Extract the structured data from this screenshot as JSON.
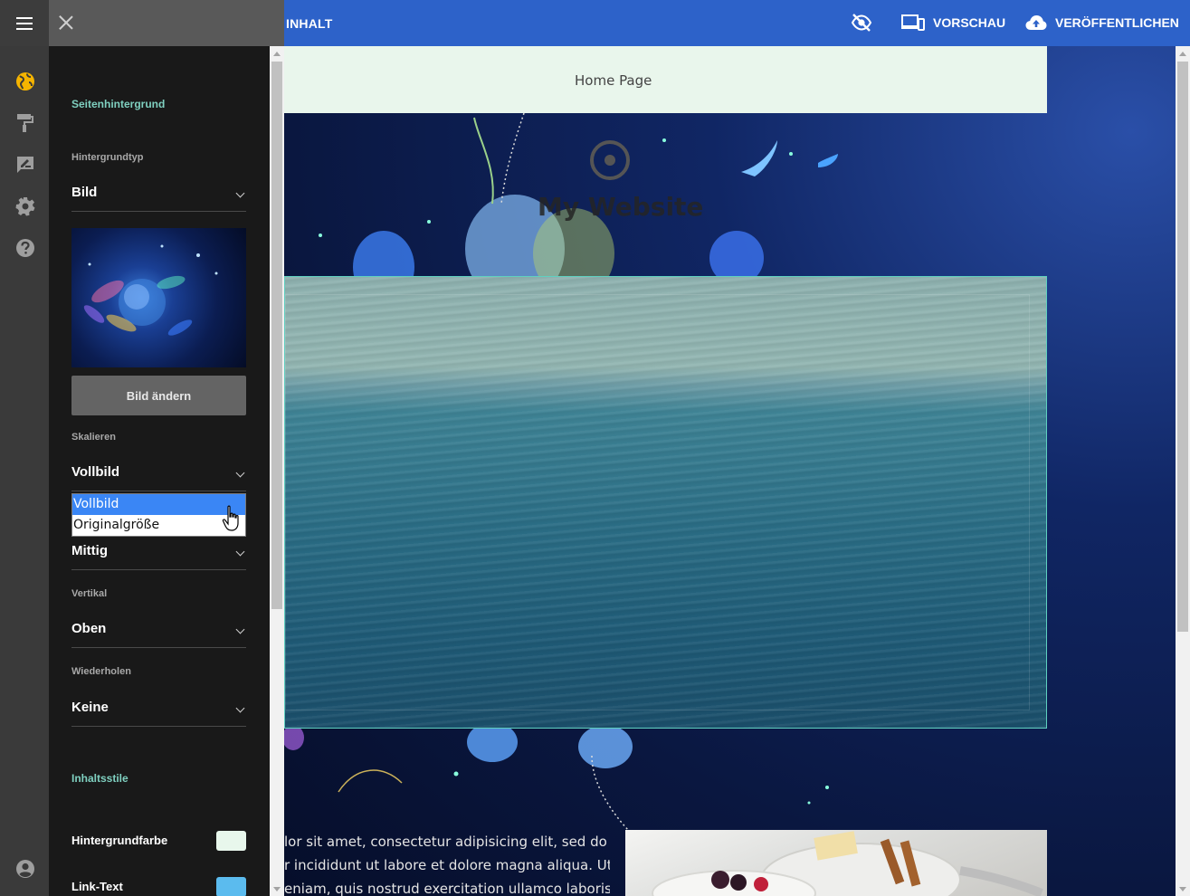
{
  "topbar": {
    "content_label": "INHALT",
    "preview_label": "VORSCHAU",
    "publish_label": "VERÖFFENTLICHEN"
  },
  "rail": {
    "icons": [
      "globe-icon",
      "paint-roller-icon",
      "feedback-icon",
      "gear-icon",
      "help-icon",
      "account-icon"
    ]
  },
  "panel": {
    "section_background": "Seitenhintergrund",
    "background_type": {
      "label": "Hintergrundtyp",
      "value": "Bild"
    },
    "change_image_button": "Bild ändern",
    "scale": {
      "label": "Skalieren",
      "value": "Vollbild",
      "options": [
        "Vollbild",
        "Originalgröße"
      ],
      "highlighted": "Vollbild"
    },
    "horizontal": {
      "value": "Mittig"
    },
    "vertical": {
      "label": "Vertikal",
      "value": "Oben"
    },
    "repeat": {
      "label": "Wiederholen",
      "value": "Keine"
    },
    "section_content_styles": "Inhaltsstile",
    "colors": [
      {
        "label": "Hintergrundfarbe",
        "value": "#e8f7ec"
      },
      {
        "label": "Link-Text",
        "value": "#5bbbee"
      }
    ]
  },
  "preview": {
    "nav_item": "Home Page",
    "site_title": "My Website",
    "body_text": [
      "lor sit amet, consectetur adipisicing elit, sed do",
      "r incididunt ut labore et dolore magna aliqua. Ut",
      "eniam, quis nostrud exercitation ullamco laboris"
    ]
  },
  "colors": {
    "topbar": "#2d62c9",
    "accent_teal": "#7fd0c0",
    "panel_bg": "#191919",
    "rail_bg": "#3a3a3a",
    "highlight": "#3a86f5"
  }
}
